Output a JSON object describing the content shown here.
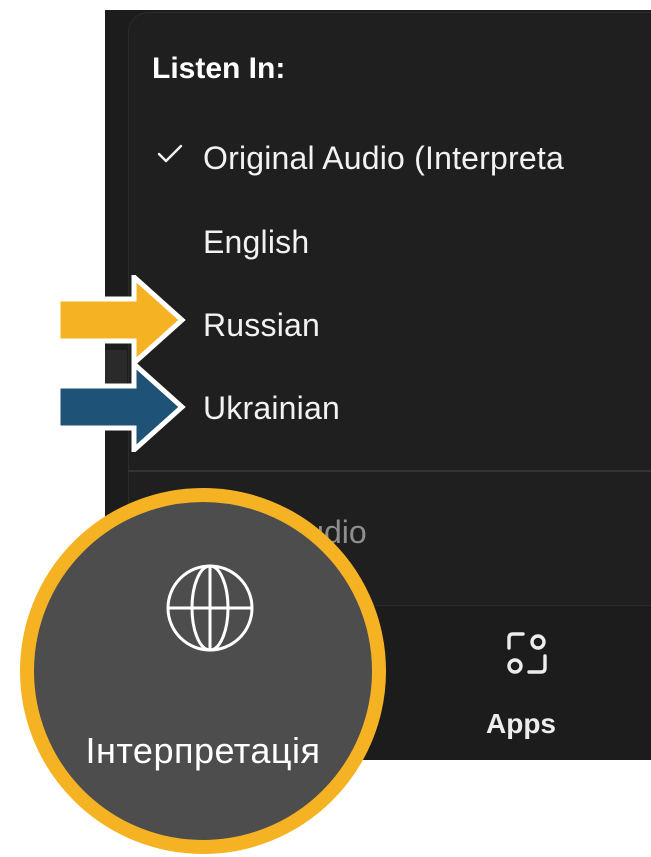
{
  "menu": {
    "heading": "Listen In:",
    "items": [
      {
        "label": "Original Audio (Interpreta",
        "checked": true
      },
      {
        "label": "English",
        "checked": false
      },
      {
        "label": "Russian",
        "checked": false
      },
      {
        "label": "Ukrainian",
        "checked": false
      }
    ],
    "mute_label": "iginal Audio"
  },
  "toolbar": {
    "apps_label": "Apps",
    "apps_icon": "apps-icon"
  },
  "interpretation": {
    "label": "Інтерпретація",
    "icon": "globe-icon"
  },
  "colors": {
    "menu_background": "#1f1f1f",
    "menu_text": "#f2f2f2",
    "muted_text": "#8e8e8e",
    "arrow_orange": "#f5b324",
    "arrow_blue": "#1e5276",
    "circle_fill": "#4d4d4d",
    "circle_border": "#f5b324"
  }
}
